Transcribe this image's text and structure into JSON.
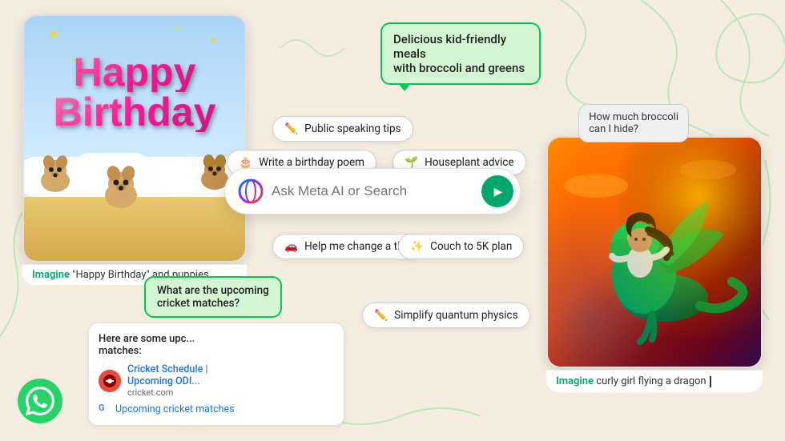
{
  "background_color": "#f5ede0",
  "birthday_card": {
    "text_line1": "Happy",
    "text_line2": "Birthday"
  },
  "imagine_labels": {
    "birthday": "Imagine",
    "birthday_text": "\"Happy Birthday\" and puppies",
    "dragon": "Imagine",
    "dragon_text": "curly girl flying a dragon"
  },
  "search": {
    "placeholder": "Ask Meta AI or Search"
  },
  "chips": [
    {
      "id": "public-speaking",
      "icon": "✏️",
      "label": "Public speaking tips"
    },
    {
      "id": "birthday-poem",
      "icon": "🎂",
      "label": "Write a birthday poem"
    },
    {
      "id": "houseplant",
      "icon": "🌱",
      "label": "Houseplant advice"
    },
    {
      "id": "tire",
      "icon": "🚗",
      "label": "Help me change a tire"
    },
    {
      "id": "couch",
      "icon": "✨",
      "label": "Couch to 5K plan"
    },
    {
      "id": "quantum",
      "icon": "✏️",
      "label": "Simplify quantum physics"
    }
  ],
  "speech_bubbles": {
    "meals": "Delicious kid-friendly meals\nwith broccoli and greens",
    "broccoli": "How much broccoli\ncan I hide?"
  },
  "cricket": {
    "question": "What are the upcoming\ncricket matches?",
    "result_intro": "Here are some upc...\nmatches:",
    "item_title": "Cricket Schedule |\nUpcoming ODI...",
    "item_url": "cricket.com",
    "google_link": "Upcoming cricket matches"
  },
  "whatsapp": {
    "aria": "WhatsApp logo"
  }
}
